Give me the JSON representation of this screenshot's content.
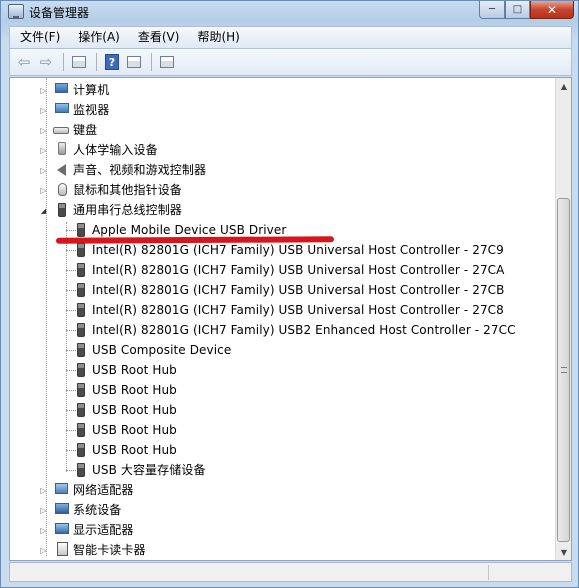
{
  "window": {
    "title": "设备管理器",
    "minimize_glyph": "─",
    "maximize_glyph": "□",
    "close_glyph": "✕"
  },
  "menu": [
    {
      "label": "文件(F)"
    },
    {
      "label": "操作(A)"
    },
    {
      "label": "查看(V)"
    },
    {
      "label": "帮助(H)"
    }
  ],
  "toolbar": {
    "back_glyph": "⇦",
    "forward_glyph": "⇨",
    "help_glyph": "?"
  },
  "tree": {
    "categories_top": [
      {
        "label": "计算机",
        "icon": "computer-icon"
      },
      {
        "label": "监视器",
        "icon": "monitor-icon"
      },
      {
        "label": "键盘",
        "icon": "keyboard-icon"
      },
      {
        "label": "人体学输入设备",
        "icon": "hid-icon"
      },
      {
        "label": "声音、视频和游戏控制器",
        "icon": "sound-icon"
      },
      {
        "label": "鼠标和其他指针设备",
        "icon": "mouse-icon"
      }
    ],
    "usb_category": {
      "label": "通用串行总线控制器",
      "icon": "usb-icon"
    },
    "usb_children": [
      {
        "label": "Apple Mobile Device USB Driver"
      },
      {
        "label": "Intel(R) 82801G (ICH7 Family) USB Universal Host Controller - 27C9"
      },
      {
        "label": "Intel(R) 82801G (ICH7 Family) USB Universal Host Controller - 27CA"
      },
      {
        "label": "Intel(R) 82801G (ICH7 Family) USB Universal Host Controller - 27CB"
      },
      {
        "label": "Intel(R) 82801G (ICH7 Family) USB Universal Host Controller - 27C8"
      },
      {
        "label": "Intel(R) 82801G (ICH7 Family) USB2 Enhanced Host Controller - 27CC"
      },
      {
        "label": "USB Composite Device"
      },
      {
        "label": "USB Root Hub"
      },
      {
        "label": "USB Root Hub"
      },
      {
        "label": "USB Root Hub"
      },
      {
        "label": "USB Root Hub"
      },
      {
        "label": "USB Root Hub"
      },
      {
        "label": "USB 大容量存储设备"
      }
    ],
    "categories_bottom": [
      {
        "label": "网络适配器",
        "icon": "network-icon"
      },
      {
        "label": "系统设备",
        "icon": "system-icon"
      },
      {
        "label": "显示适配器",
        "icon": "display-icon"
      },
      {
        "label": "智能卡读卡器",
        "icon": "smartcard-icon"
      }
    ],
    "collapsed_glyph": "▷",
    "expanded_glyph": "◢"
  },
  "colors": {
    "annotation_red": "#d8151c",
    "window_frame": "#b9d1ea"
  }
}
